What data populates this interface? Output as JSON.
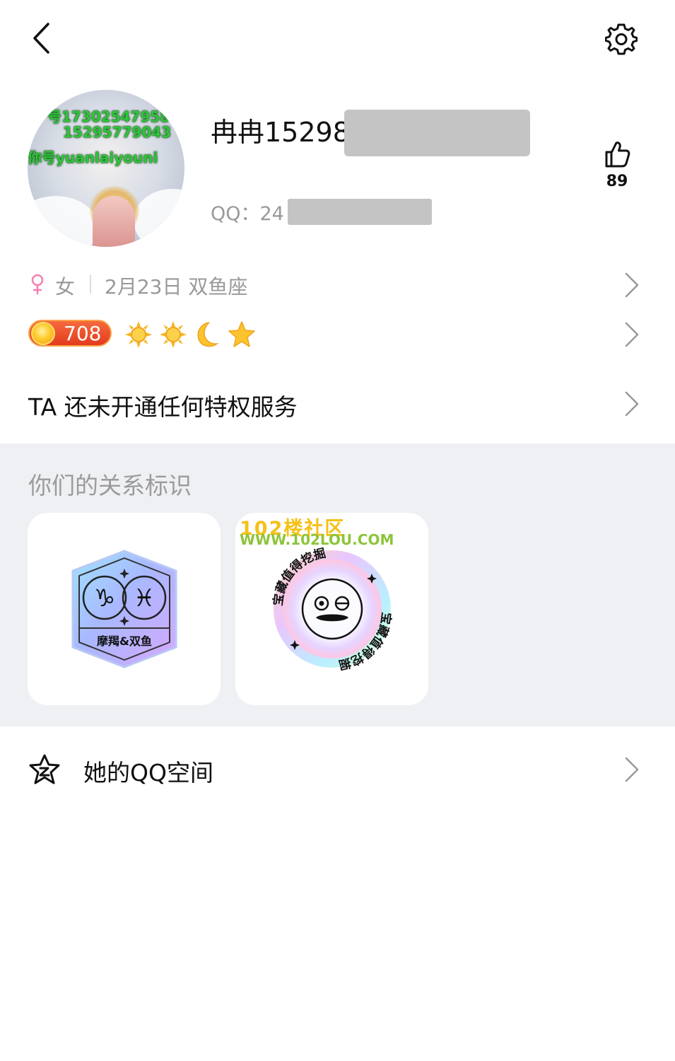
{
  "header": {
    "back_icon": "chevron-left-icon",
    "settings_icon": "gear-icon"
  },
  "profile": {
    "avatar_overlay_lines": [
      "号17302547958",
      "15295779043",
      "你号yuanlaiyouni"
    ],
    "nickname": "冉冉15298                        1879244）",
    "qq_label": "QQ：24",
    "like_icon": "thumbs-up-icon",
    "like_count": "89"
  },
  "info": {
    "gender_icon": "female-icon",
    "gender": "女",
    "birthday": "2月23日 双鱼座"
  },
  "level": {
    "value": "708",
    "icons": [
      "sun-icon",
      "sun-icon",
      "moon-icon",
      "star-icon"
    ]
  },
  "privilege": {
    "text": "TA 还未开通任何特权服务"
  },
  "relation": {
    "title": "你们的关系标识",
    "cards": [
      {
        "icon": "zodiac-badge-icon",
        "label": "摩羯&双鱼"
      },
      {
        "icon": "treasure-badge-icon",
        "ring_text": "宝藏值得挖掘",
        "watermark_title": "102楼社区",
        "watermark_url": "WWW.102LOU.COM"
      }
    ]
  },
  "qzone": {
    "icon": "qzone-star-icon",
    "label": "她的QQ空间"
  },
  "colors": {
    "background": "#ffffff",
    "section_bg": "#eff0f3",
    "secondary_text": "#999999",
    "female_pink": "#f27fb2",
    "level_red": "#e33b1f"
  }
}
